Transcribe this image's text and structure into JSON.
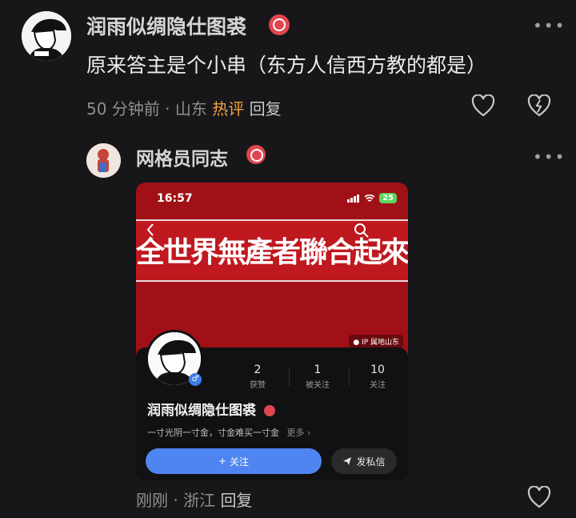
{
  "comment1": {
    "username": "润雨似绸隐仕图裘",
    "text": "原来答主是个小串（东方人信西方教的都是）",
    "time": "50 分钟前",
    "dot": "·",
    "location": "山东",
    "hot_label": "热评",
    "reply_label": "回复"
  },
  "comment2": {
    "username": "网格员同志",
    "time": "刚刚",
    "dot": "·",
    "location": "浙江",
    "reply_label": "回复"
  },
  "embedded_screenshot": {
    "time": "16:57",
    "battery": "25",
    "slogan": "全世界無產者聯合起來！",
    "ip_label": "IP 属地山东",
    "profile_name": "润雨似绸隐仕图裘",
    "stats": [
      {
        "value": "2",
        "label": "获赞"
      },
      {
        "value": "1",
        "label": "被关注"
      },
      {
        "value": "10",
        "label": "关注"
      }
    ],
    "bio": "一寸光阴一寸金，寸金难买一寸金",
    "more_label": "更多 ›",
    "follow_label": "关注",
    "dm_label": "发私信"
  },
  "colors": {
    "background": "#17171a",
    "hot": "#f4a13a",
    "badge_red": "#e0464f",
    "banner_red": "#c0181f",
    "follow_blue": "#4f85f0"
  },
  "icons": [
    "more-icon",
    "heart-icon",
    "dislike-icon",
    "verified-badge-icon",
    "shield-badge-icon",
    "back-arrow-icon",
    "search-icon",
    "location-pin-icon",
    "plus-icon",
    "send-icon",
    "male-icon"
  ]
}
